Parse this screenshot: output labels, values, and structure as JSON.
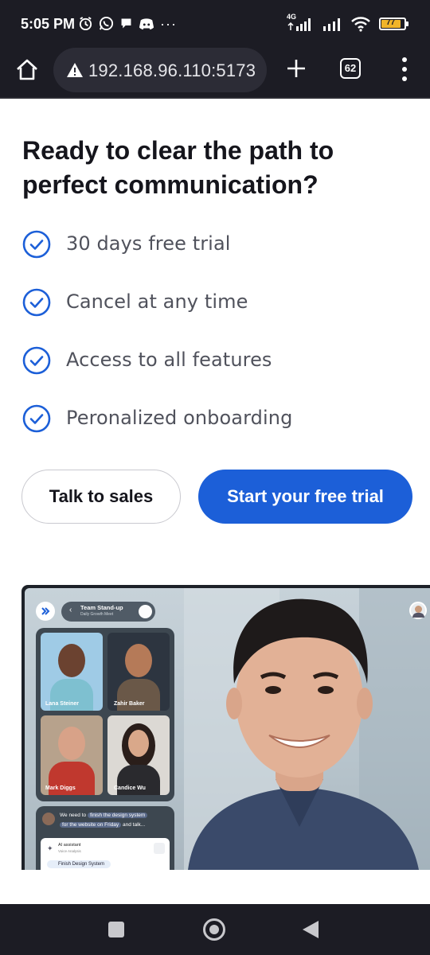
{
  "status_bar": {
    "time": "5:05 PM",
    "icons_left": [
      "alarm-icon",
      "whatsapp-icon",
      "chat-icon",
      "discord-icon",
      "more-dots-icon"
    ],
    "more_dots": "···",
    "network": "4G",
    "battery": "77"
  },
  "browser": {
    "url": "192.168.96.110:5173",
    "tab_count": "62"
  },
  "hero": {
    "headline": "Ready to clear the path to perfect communication?",
    "features": [
      {
        "label": "30 days free trial"
      },
      {
        "label": "Cancel at any time"
      },
      {
        "label": "Access to all features"
      },
      {
        "label": "Peronalized onboarding"
      }
    ],
    "accent_color": "#1c5fd8",
    "sales_button": "Talk to sales",
    "trial_button": "Start your free trial"
  },
  "preview": {
    "meeting_title": "Team Stand-up",
    "meeting_subtitle": "Daily Growth Meet",
    "participants": [
      {
        "name": "Lana Steiner"
      },
      {
        "name": "Zahir Baker"
      },
      {
        "name": "Mark Diggs"
      },
      {
        "name": "Candice Wu"
      }
    ],
    "chat_prefix": "We need to",
    "chat_highlight_1": "finish the design system",
    "chat_highlight_2": "for the website on Friday",
    "chat_suffix": "and talk...",
    "assistant_title": "AI assistant",
    "assistant_subtitle": "Voice Analysis",
    "task_chip": "Finish Design System"
  }
}
